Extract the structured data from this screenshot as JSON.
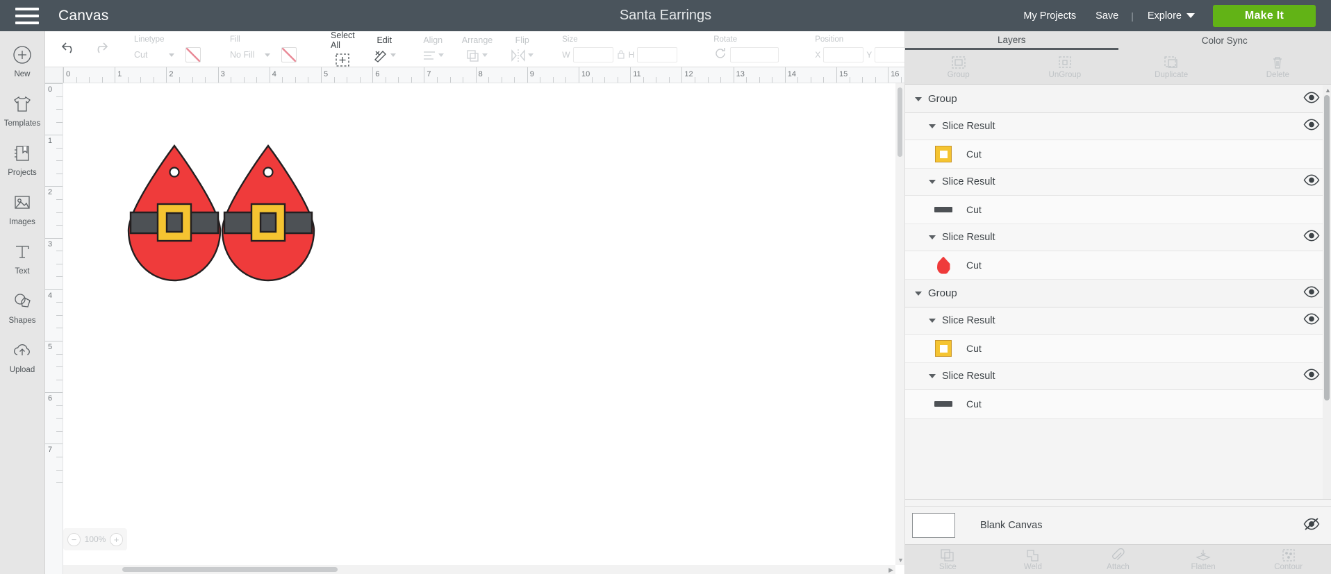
{
  "topbar": {
    "menu_icon": "hamburger-icon",
    "canvas_label": "Canvas",
    "document_title": "Santa Earrings",
    "my_projects": "My Projects",
    "save": "Save",
    "separator": "|",
    "explore": "Explore",
    "make_it": "Make It",
    "bg_color": "#4a545c",
    "make_it_color": "#62b316"
  },
  "sidebar": {
    "items": [
      {
        "label": "New",
        "icon": "plus-circle-icon"
      },
      {
        "label": "Templates",
        "icon": "tshirt-icon"
      },
      {
        "label": "Projects",
        "icon": "book-bookmark-icon"
      },
      {
        "label": "Images",
        "icon": "image-icon"
      },
      {
        "label": "Text",
        "icon": "text-t-icon"
      },
      {
        "label": "Shapes",
        "icon": "shapes-icon"
      },
      {
        "label": "Upload",
        "icon": "cloud-upload-icon"
      }
    ]
  },
  "toolbar": {
    "undo": "undo-icon",
    "redo": "redo-icon",
    "linetype": {
      "label": "Linetype",
      "value": "Cut"
    },
    "fill": {
      "label": "Fill",
      "value": "No Fill"
    },
    "select_all": "Select All",
    "edit": "Edit",
    "align": "Align",
    "arrange": "Arrange",
    "flip": "Flip",
    "size": {
      "label": "Size",
      "w": "W",
      "h": "H",
      "w_value": "",
      "h_value": ""
    },
    "rotate": {
      "label": "Rotate",
      "value": ""
    },
    "position": {
      "label": "Position",
      "x": "X",
      "y": "Y",
      "x_value": "",
      "y_value": ""
    }
  },
  "canvas": {
    "zoom_level": "100%",
    "zoom_out": "−",
    "zoom_in": "+",
    "ruler_h_labels": [
      "0",
      "1",
      "2",
      "3",
      "4",
      "5",
      "6",
      "7",
      "8",
      "9",
      "10",
      "11",
      "12",
      "13",
      "14",
      "15",
      "16"
    ],
    "ruler_v_labels": [
      "0",
      "1",
      "2",
      "3",
      "4",
      "5",
      "6",
      "7"
    ],
    "artwork": {
      "name": "santa-earrings",
      "red": "#ef3b3b",
      "belt": "#4d5155",
      "buckle": "#f5c431",
      "outline": "#231f20",
      "count": 2
    }
  },
  "right_panel": {
    "tabs": [
      {
        "label": "Layers",
        "active": true
      },
      {
        "label": "Color Sync",
        "active": false
      }
    ],
    "tools": [
      {
        "label": "Group",
        "icon": "group-icon"
      },
      {
        "label": "UnGroup",
        "icon": "ungroup-icon"
      },
      {
        "label": "Duplicate",
        "icon": "duplicate-icon"
      },
      {
        "label": "Delete",
        "icon": "trash-icon"
      }
    ],
    "layers": [
      {
        "kind": "group",
        "label": "Group",
        "visible": true
      },
      {
        "kind": "child",
        "label": "Slice Result",
        "visible": true
      },
      {
        "kind": "leaf",
        "label": "Cut",
        "chip": "square-outline-yellow"
      },
      {
        "kind": "child",
        "label": "Slice Result",
        "visible": true
      },
      {
        "kind": "leaf",
        "label": "Cut",
        "chip": "bar-grey"
      },
      {
        "kind": "child",
        "label": "Slice Result",
        "visible": true
      },
      {
        "kind": "leaf",
        "label": "Cut",
        "chip": "drop-red"
      },
      {
        "kind": "group",
        "label": "Group",
        "visible": true
      },
      {
        "kind": "child",
        "label": "Slice Result",
        "visible": true
      },
      {
        "kind": "leaf",
        "label": "Cut",
        "chip": "square-outline-yellow"
      },
      {
        "kind": "child",
        "label": "Slice Result",
        "visible": true
      },
      {
        "kind": "leaf",
        "label": "Cut",
        "chip": "bar-grey"
      }
    ],
    "blank_canvas": {
      "label": "Blank Canvas",
      "visible": false
    },
    "bottom_tools": [
      {
        "label": "Slice",
        "icon": "slice-icon"
      },
      {
        "label": "Weld",
        "icon": "weld-icon"
      },
      {
        "label": "Attach",
        "icon": "paperclip-icon"
      },
      {
        "label": "Flatten",
        "icon": "flatten-icon"
      },
      {
        "label": "Contour",
        "icon": "contour-icon"
      }
    ]
  }
}
